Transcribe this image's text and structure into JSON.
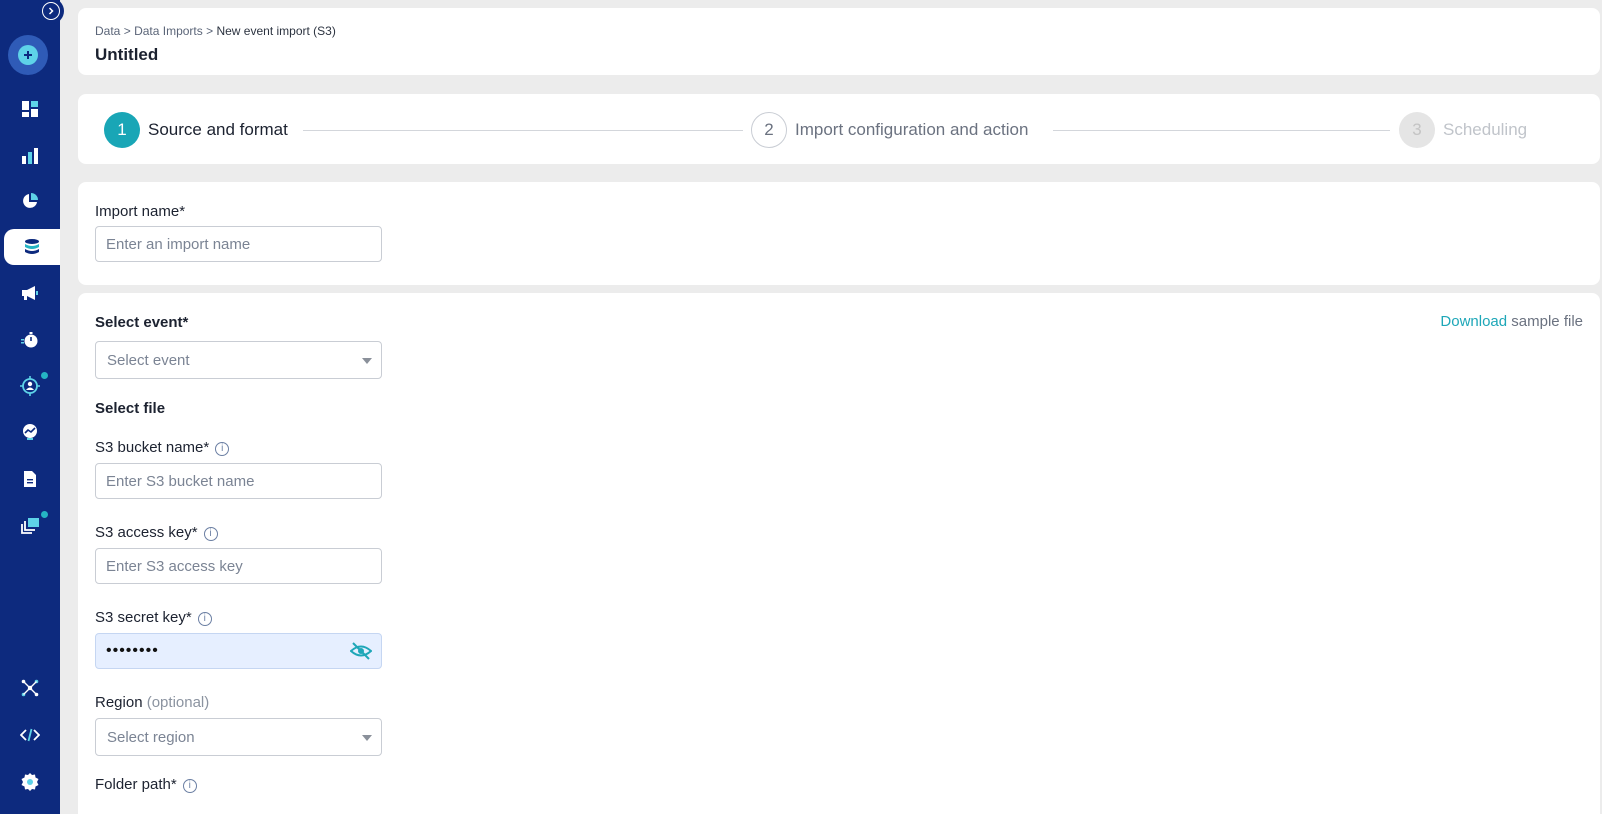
{
  "breadcrumb": {
    "items": [
      "Data",
      "Data Imports"
    ],
    "separator": ">",
    "current": "New event import (S3)"
  },
  "page_title": "Untitled",
  "stepper": {
    "steps": [
      {
        "number": "1",
        "label": "Source and format",
        "state": "active"
      },
      {
        "number": "2",
        "label": "Import configuration and action",
        "state": "upcoming"
      },
      {
        "number": "3",
        "label": "Scheduling",
        "state": "disabled"
      }
    ]
  },
  "form": {
    "import_name": {
      "label": "Import name*",
      "placeholder": "Enter an import name",
      "value": ""
    },
    "select_event": {
      "label": "Select event*",
      "placeholder": "Select event"
    },
    "download": {
      "link": "Download",
      "rest": " sample file"
    },
    "select_file_heading": "Select file",
    "bucket": {
      "label": "S3 bucket name*",
      "placeholder": "Enter S3 bucket name",
      "value": ""
    },
    "access_key": {
      "label": "S3 access key*",
      "placeholder": "Enter S3 access key",
      "value": ""
    },
    "secret_key": {
      "label": "S3 secret key*",
      "masked_value": "••••••••"
    },
    "region": {
      "label": "Region",
      "optional": "(optional)",
      "placeholder": "Select region"
    },
    "folder_path": {
      "label": "Folder path*"
    }
  },
  "colors": {
    "sidebar_bg": "#0d2a7e",
    "accent": "#1ea7b8",
    "active_step": "#19a6b6"
  },
  "sidebar": {
    "items": [
      "toggle-icon",
      "create-icon",
      "dashboard-icon",
      "analytics-icon",
      "segments-icon",
      "data-icon",
      "campaigns-icon",
      "flows-icon",
      "personalization-icon",
      "insights-icon",
      "reports-icon",
      "content-icon",
      "integrations-icon",
      "developer-icon",
      "settings-icon"
    ]
  }
}
